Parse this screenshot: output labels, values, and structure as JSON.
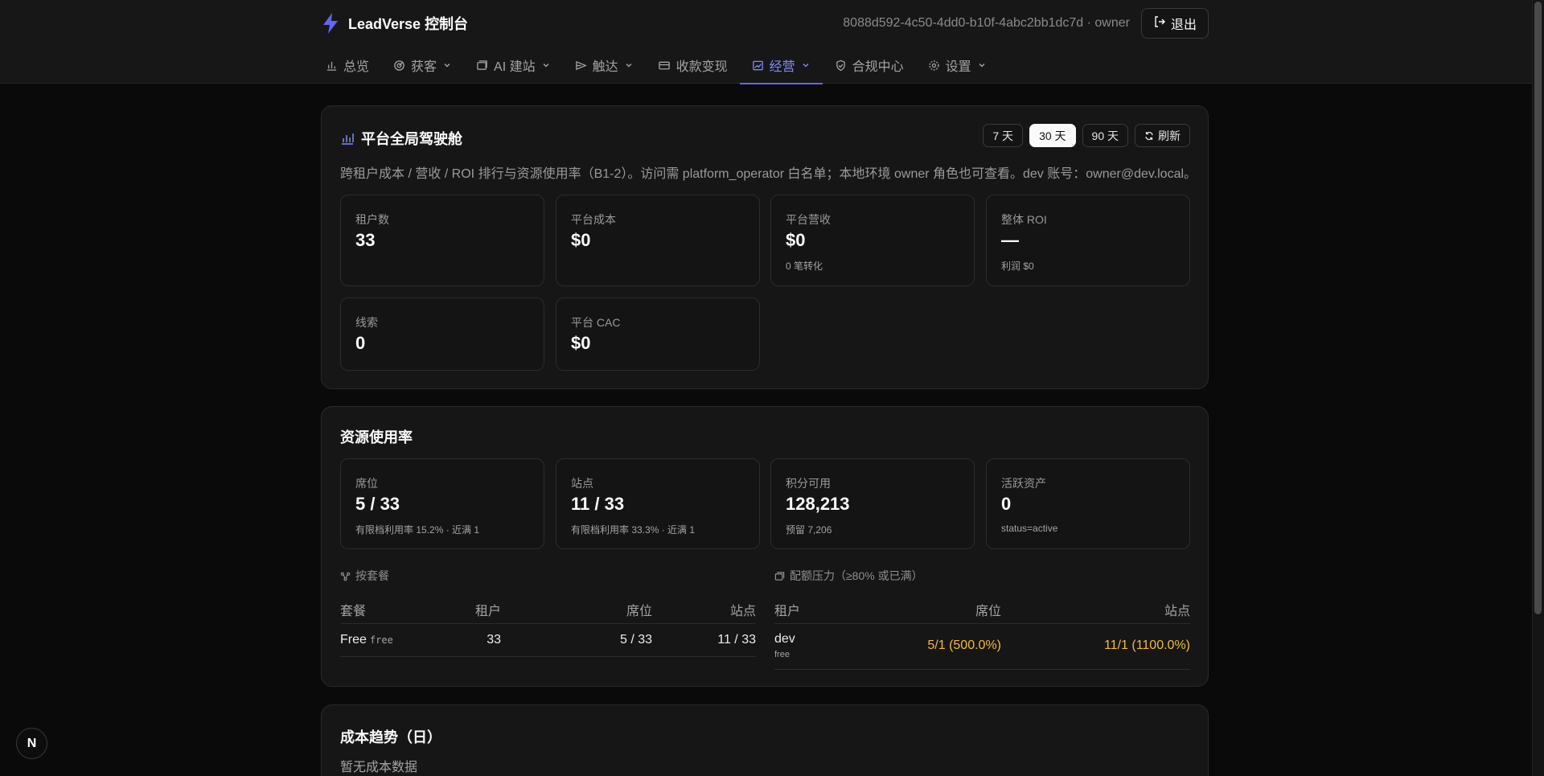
{
  "header": {
    "brand": "LeadVerse 控制台",
    "session": "8088d592-4c50-4dd0-b10f-4abc2bb1dc7d · owner",
    "logout_label": "退出"
  },
  "nav": [
    {
      "label": "总览",
      "icon": "bar-chart-icon",
      "dropdown": false
    },
    {
      "label": "获客",
      "icon": "target-icon",
      "dropdown": true
    },
    {
      "label": "AI 建站",
      "icon": "window-icon",
      "dropdown": true
    },
    {
      "label": "触达",
      "icon": "send-icon",
      "dropdown": true
    },
    {
      "label": "收款变现",
      "icon": "credit-card-icon",
      "dropdown": false
    },
    {
      "label": "经营",
      "icon": "image-chart-icon",
      "dropdown": true,
      "active": true
    },
    {
      "label": "合规中心",
      "icon": "shield-check-icon",
      "dropdown": false
    },
    {
      "label": "设置",
      "icon": "gear-icon",
      "dropdown": true
    }
  ],
  "cockpit": {
    "title": "平台全局驾驶舱",
    "ranges": [
      "7 天",
      "30 天",
      "90 天"
    ],
    "active_range": "30 天",
    "refresh_label": "刷新",
    "description": "跨租户成本 / 营收 / ROI 排行与资源使用率（B1-2）。访问需 platform_operator 白名单；本地环境 owner 角色也可查看。dev 账号：owner@dev.local。",
    "cards": [
      {
        "label": "租户数",
        "value": "33",
        "sub": ""
      },
      {
        "label": "平台成本",
        "value": "$0",
        "sub": ""
      },
      {
        "label": "平台营收",
        "value": "$0",
        "sub": "0 笔转化"
      },
      {
        "label": "整体 ROI",
        "value": "—",
        "sub": "利润 $0"
      },
      {
        "label": "线索",
        "value": "0",
        "sub": ""
      },
      {
        "label": "平台 CAC",
        "value": "$0",
        "sub": ""
      }
    ]
  },
  "resources": {
    "title": "资源使用率",
    "cards": [
      {
        "label": "席位",
        "value": "5 / 33",
        "sub": "有限档利用率 15.2% · 近满 1"
      },
      {
        "label": "站点",
        "value": "11 / 33",
        "sub": "有限档利用率 33.3% · 近满 1"
      },
      {
        "label": "积分可用",
        "value": "128,213",
        "sub": "预留 7,206"
      },
      {
        "label": "活跃资产",
        "value": "0",
        "sub": "status=active"
      }
    ],
    "plans": {
      "label": "按套餐",
      "columns": [
        "套餐",
        "租户",
        "席位",
        "站点"
      ],
      "rows": [
        {
          "plan": "Free",
          "code": "free",
          "tenants": "33",
          "seats": "5 / 33",
          "sites": "11 / 33"
        }
      ]
    },
    "pressure": {
      "label": "配额压力（≥80% 或已满）",
      "columns": [
        "租户",
        "席位",
        "站点"
      ],
      "rows": [
        {
          "tenant": "dev",
          "plan": "free",
          "seats": "5/1 (500.0%)",
          "sites": "11/1 (1100.0%)"
        }
      ]
    }
  },
  "cost_trend": {
    "title": "成本趋势（日）",
    "empty": "暂无成本数据"
  },
  "badge": "N",
  "colors": {
    "accent": "#6366f1",
    "warning": "#f5b93e",
    "background": "#0a0a0a",
    "panel": "#161616"
  }
}
